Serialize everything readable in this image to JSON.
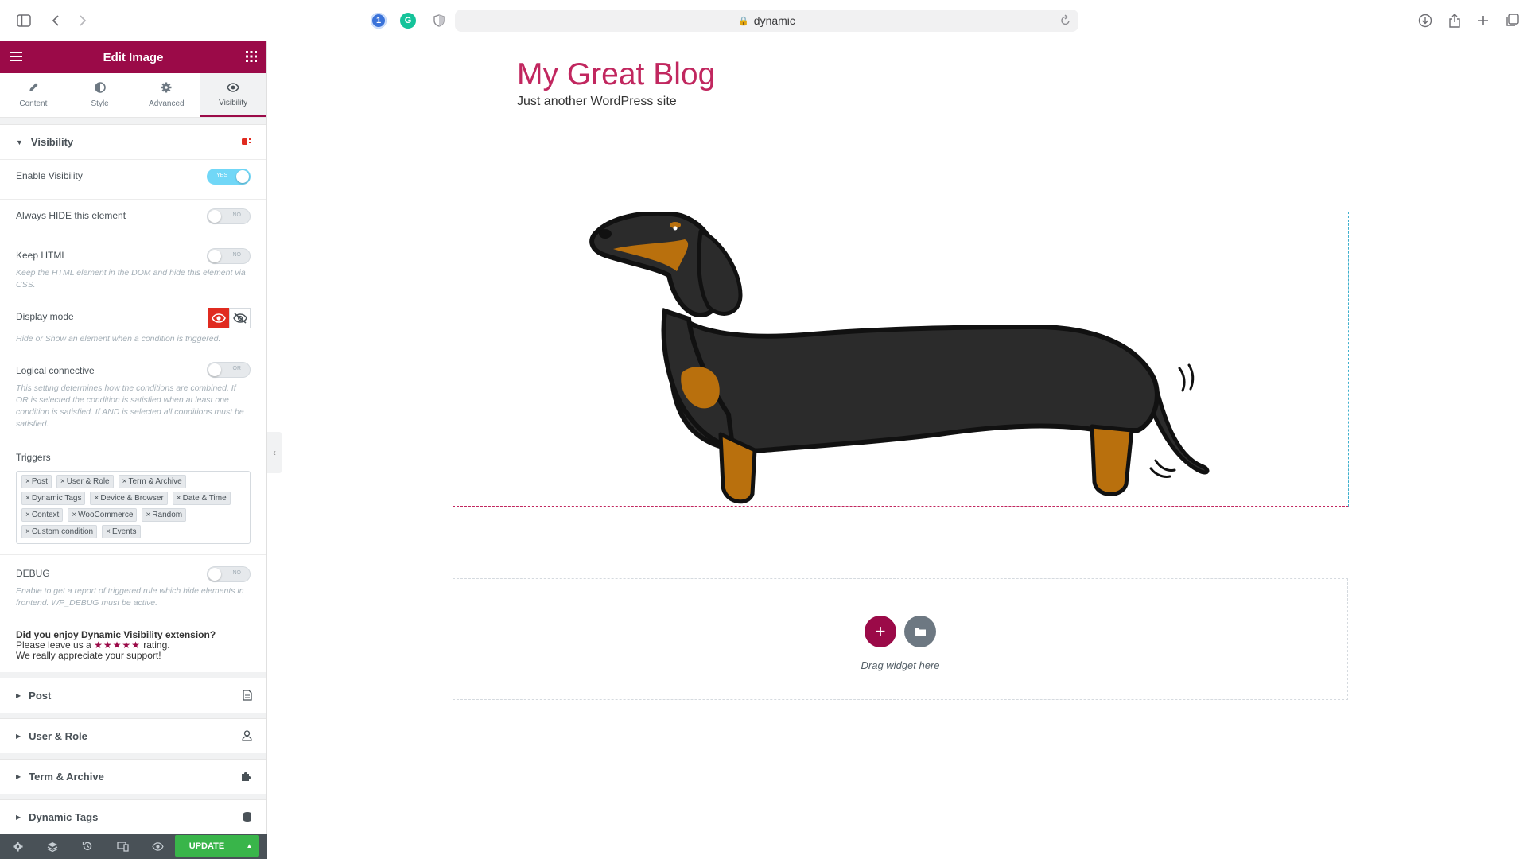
{
  "browser": {
    "url_text": "dynamic",
    "extensions": [
      "1password-icon",
      "grammarly-icon",
      "shield-icon"
    ]
  },
  "panel": {
    "title": "Edit Image",
    "tabs": [
      {
        "label": "Content",
        "icon": "pencil-icon"
      },
      {
        "label": "Style",
        "icon": "half-circle-icon"
      },
      {
        "label": "Advanced",
        "icon": "gear-icon"
      },
      {
        "label": "Visibility",
        "icon": "eye-icon",
        "active": true
      }
    ],
    "section_title": "Visibility",
    "controls": {
      "enable_visibility": {
        "label": "Enable Visibility",
        "state": "YES"
      },
      "always_hide": {
        "label": "Always HIDE this element",
        "state": "NO"
      },
      "keep_html": {
        "label": "Keep HTML",
        "state": "NO",
        "description": "Keep the HTML element in the DOM and hide this element via CSS."
      },
      "display_mode": {
        "label": "Display mode",
        "description": "Hide or Show an element when a condition is triggered."
      },
      "logical_connective": {
        "label": "Logical connective",
        "state": "OR",
        "description": "This setting determines how the conditions are combined. If OR is selected the condition is satisfied when at least one condition is satisfied. If AND is selected all conditions must be satisfied."
      },
      "triggers": {
        "label": "Triggers",
        "items": [
          "Post",
          "User & Role",
          "Term & Archive",
          "Dynamic Tags",
          "Device & Browser",
          "Date & Time",
          "Context",
          "WooCommerce",
          "Random",
          "Custom condition",
          "Events"
        ]
      },
      "debug": {
        "label": "DEBUG",
        "state": "NO",
        "description": "Enable to get a report of triggered rule which hide elements in frontend. WP_DEBUG must be active."
      }
    },
    "promo": {
      "line1": "Did you enjoy Dynamic Visibility extension?",
      "line2_before": "Please leave us a",
      "stars": "★★★★★",
      "line2_after": "rating.",
      "line3": "We really appreciate your support!"
    },
    "collapsed_sections": [
      {
        "label": "Post",
        "icon": "document-icon"
      },
      {
        "label": "User & Role",
        "icon": "user-icon"
      },
      {
        "label": "Term & Archive",
        "icon": "puzzle-icon"
      },
      {
        "label": "Dynamic Tags",
        "icon": "database-icon"
      }
    ],
    "footer": {
      "update_label": "UPDATE"
    }
  },
  "site": {
    "title": "My Great Blog",
    "tagline": "Just another WordPress site"
  },
  "dropzone": {
    "text": "Drag widget here"
  },
  "colors": {
    "brand": "#9b0a48",
    "site_title": "#c1275f",
    "switch_on": "#71d7f7",
    "display_mode_active": "#e02b20",
    "update": "#39b54a"
  }
}
